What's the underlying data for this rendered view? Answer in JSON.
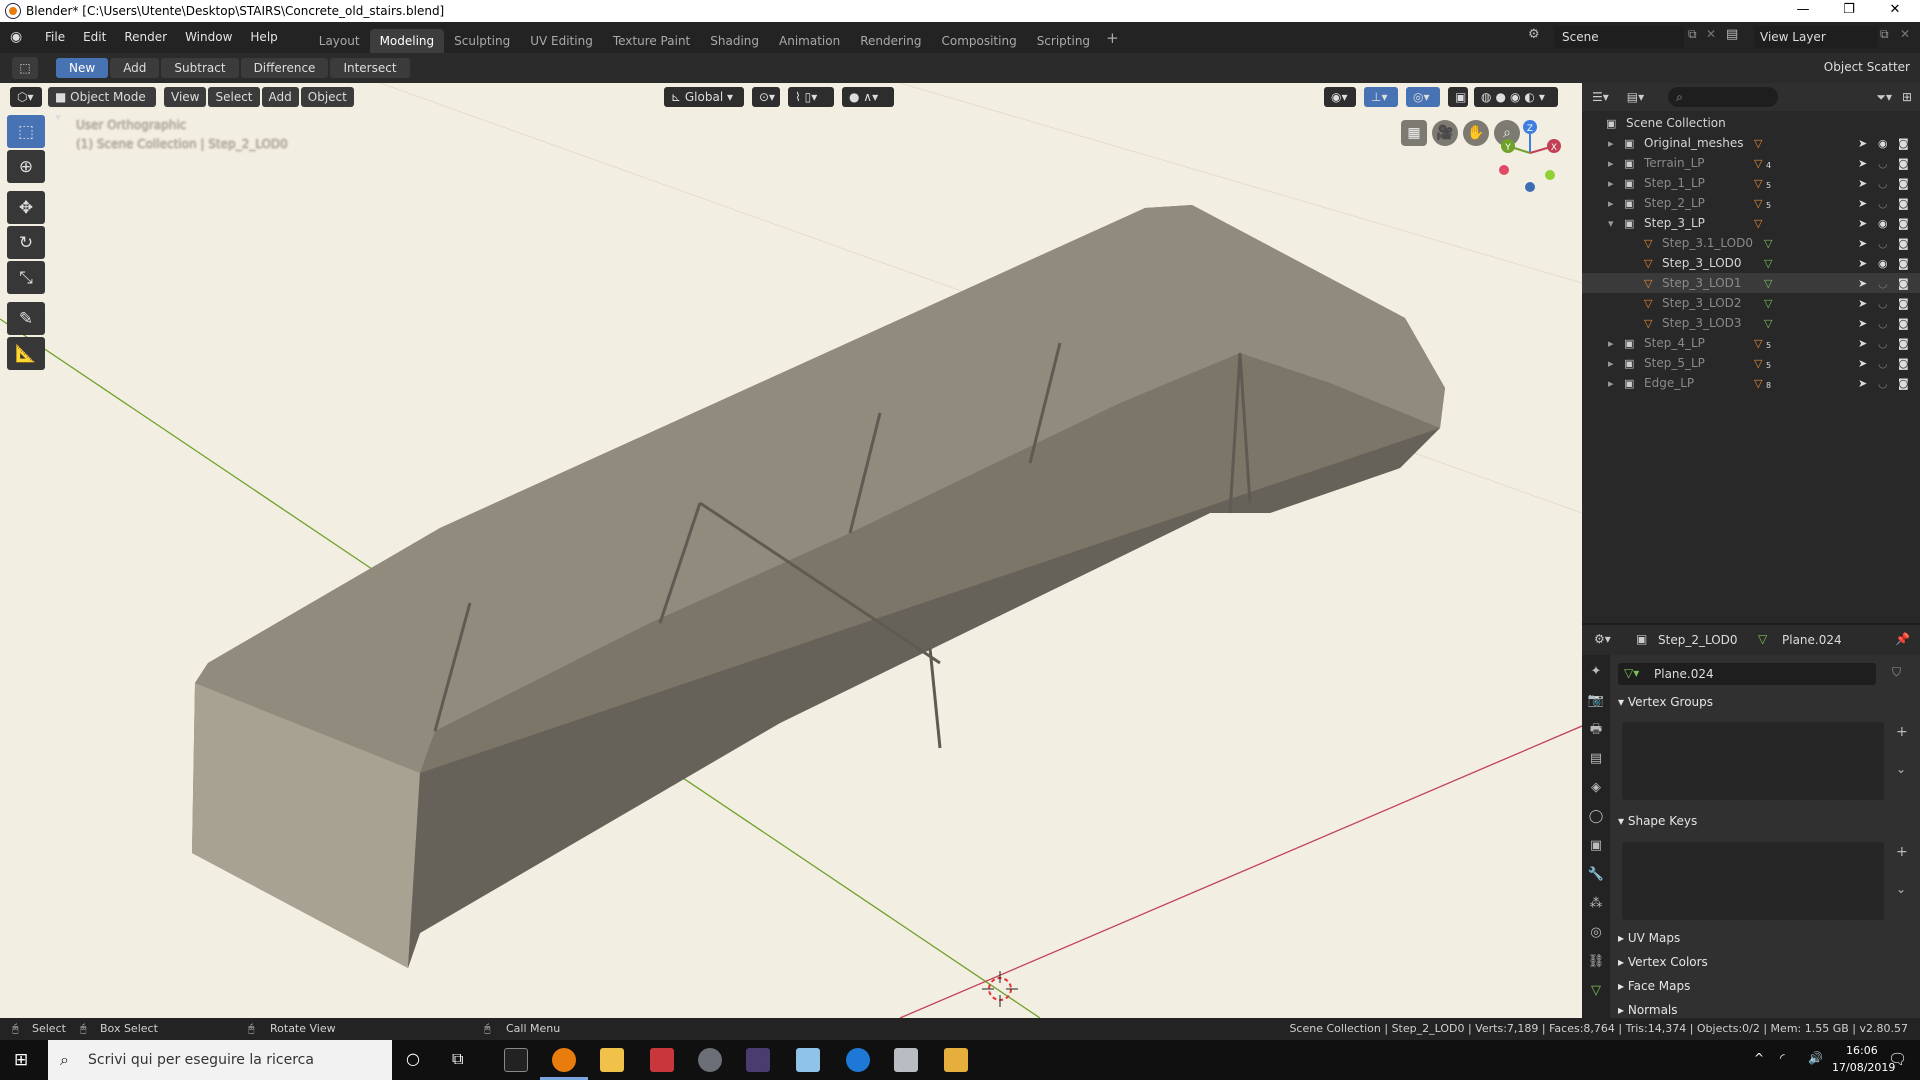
{
  "window": {
    "title": "Blender* [C:\\Users\\Utente\\Desktop\\STAIRS\\Concrete_old_stairs.blend]"
  },
  "menubar": {
    "menus": [
      "File",
      "Edit",
      "Render",
      "Window",
      "Help"
    ],
    "workspaces": [
      "Layout",
      "Modeling",
      "Sculpting",
      "UV Editing",
      "Texture Paint",
      "Shading",
      "Animation",
      "Rendering",
      "Compositing",
      "Scripting"
    ],
    "active_workspace": "Modeling",
    "scene": "Scene",
    "view_layer": "View Layer"
  },
  "toolbar": {
    "buttons": [
      "New",
      "Add",
      "Subtract",
      "Difference",
      "Intersect"
    ],
    "active": "New",
    "addon": "Object Scatter"
  },
  "viewport": {
    "mode": "Object Mode",
    "menus": [
      "View",
      "Select",
      "Add",
      "Object"
    ],
    "orientation": "Global",
    "view_name": "User Orthographic",
    "collection_info": "(1) Scene Collection | Step_2_LOD0",
    "gizmo_axes": [
      "Z",
      "Y",
      "X"
    ]
  },
  "outliner": {
    "root": "Scene Collection",
    "rows": [
      {
        "name": "Original_meshes",
        "dim": false,
        "badge": ""
      },
      {
        "name": "Terrain_LP",
        "dim": true,
        "badge": "4"
      },
      {
        "name": "Step_1_LP",
        "dim": true,
        "badge": "5"
      },
      {
        "name": "Step_2_LP",
        "dim": true,
        "badge": "5"
      },
      {
        "name": "Step_3_LP",
        "dim": false,
        "badge": ""
      },
      {
        "name": "Step_3.1_LOD0",
        "dim": true,
        "badge": ""
      },
      {
        "name": "Step_3_LOD0",
        "dim": false,
        "badge": ""
      },
      {
        "name": "Step_3_LOD1",
        "dim": true,
        "badge": ""
      },
      {
        "name": "Step_3_LOD2",
        "dim": true,
        "badge": ""
      },
      {
        "name": "Step_3_LOD3",
        "dim": true,
        "badge": ""
      },
      {
        "name": "Step_4_LP",
        "dim": true,
        "badge": "5"
      },
      {
        "name": "Step_5_LP",
        "dim": true,
        "badge": "5"
      },
      {
        "name": "Edge_LP",
        "dim": true,
        "badge": "8"
      }
    ]
  },
  "properties": {
    "object": "Step_2_LOD0",
    "mesh": "Plane.024",
    "mesh_field": "Plane.024",
    "sections": [
      "Vertex Groups",
      "Shape Keys",
      "UV Maps",
      "Vertex Colors",
      "Face Maps",
      "Normals"
    ]
  },
  "statusbar": {
    "select": "Select",
    "box_select": "Box Select",
    "rotate": "Rotate View",
    "call_menu": "Call Menu",
    "stats": "Scene Collection | Step_2_LOD0 | Verts:7,189 | Faces:8,764 | Tris:14,374 | Objects:0/2 | Mem: 1.55 GB | v2.80.57"
  },
  "taskbar": {
    "search_placeholder": "Scrivi qui per eseguire la ricerca",
    "time": "16:06",
    "date": "17/08/2019"
  },
  "colors": {
    "accent": "#4772b3",
    "viewport_bg": "#f3eee2",
    "x_axis": "#c24055",
    "y_axis": "#6fa12b"
  }
}
